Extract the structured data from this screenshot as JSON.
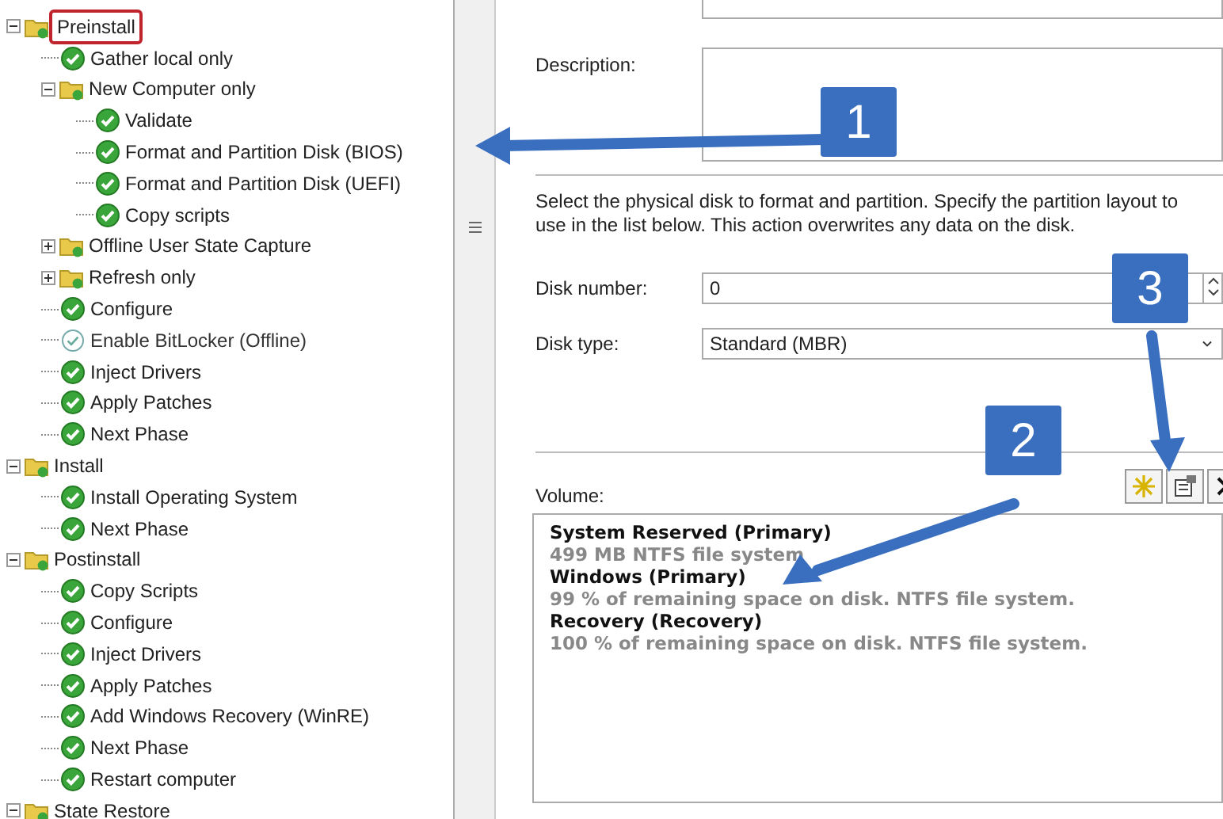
{
  "tree": [
    {
      "kind": "group",
      "label": "Preinstall",
      "expanded": true,
      "highlighted": true,
      "children": [
        {
          "kind": "step",
          "label": "Gather local only",
          "enabled": true
        },
        {
          "kind": "group",
          "label": "New Computer only",
          "expanded": true,
          "highlighted": false,
          "children": [
            {
              "kind": "step",
              "label": "Validate",
              "enabled": true
            },
            {
              "kind": "step",
              "label": "Format and Partition Disk (BIOS)",
              "enabled": true
            },
            {
              "kind": "step",
              "label": "Format and Partition Disk (UEFI)",
              "enabled": true
            },
            {
              "kind": "step",
              "label": "Copy scripts",
              "enabled": true
            }
          ]
        },
        {
          "kind": "group",
          "label": "Offline User State Capture",
          "expanded": false,
          "highlighted": false
        },
        {
          "kind": "group",
          "label": "Refresh only",
          "expanded": false,
          "highlighted": false
        },
        {
          "kind": "step",
          "label": "Configure",
          "enabled": true
        },
        {
          "kind": "step",
          "label": "Enable BitLocker (Offline)",
          "enabled": false
        },
        {
          "kind": "step",
          "label": "Inject Drivers",
          "enabled": true
        },
        {
          "kind": "step",
          "label": "Apply Patches",
          "enabled": true
        },
        {
          "kind": "step",
          "label": "Next Phase",
          "enabled": true
        }
      ]
    },
    {
      "kind": "group",
      "label": "Install",
      "expanded": true,
      "highlighted": false,
      "children": [
        {
          "kind": "step",
          "label": "Install Operating System",
          "enabled": true
        },
        {
          "kind": "step",
          "label": "Next Phase",
          "enabled": true
        }
      ]
    },
    {
      "kind": "group",
      "label": "Postinstall",
      "expanded": true,
      "highlighted": false,
      "children": [
        {
          "kind": "step",
          "label": "Copy Scripts",
          "enabled": true
        },
        {
          "kind": "step",
          "label": "Configure",
          "enabled": true
        },
        {
          "kind": "step",
          "label": "Inject Drivers",
          "enabled": true
        },
        {
          "kind": "step",
          "label": "Apply Patches",
          "enabled": true
        },
        {
          "kind": "step",
          "label": "Add Windows Recovery (WinRE)",
          "enabled": true
        },
        {
          "kind": "step",
          "label": "Next Phase",
          "enabled": true
        },
        {
          "kind": "step",
          "label": "Restart computer",
          "enabled": true
        }
      ]
    },
    {
      "kind": "group",
      "label": "State Restore",
      "expanded": true,
      "highlighted": false
    }
  ],
  "properties": {
    "description_label": "Description:",
    "instructions": "Select the physical disk to format and partition.  Specify the partition layout to use in the list below. This action overwrites any data on the disk.",
    "disk_number": {
      "label": "Disk number:",
      "value": "0"
    },
    "disk_type": {
      "label": "Disk type:",
      "value": "Standard (MBR)"
    },
    "volume_label": "Volume:",
    "volumes": [
      {
        "title": "System Reserved (Primary)",
        "detail": "499 MB NTFS file system"
      },
      {
        "title": "Windows (Primary)",
        "detail": "99 % of remaining space on disk. NTFS file system."
      },
      {
        "title": "Recovery (Recovery)",
        "detail": "100 % of remaining space on disk. NTFS file system."
      }
    ]
  },
  "callouts": [
    {
      "label": "1"
    },
    {
      "label": "2"
    },
    {
      "label": "3"
    }
  ]
}
